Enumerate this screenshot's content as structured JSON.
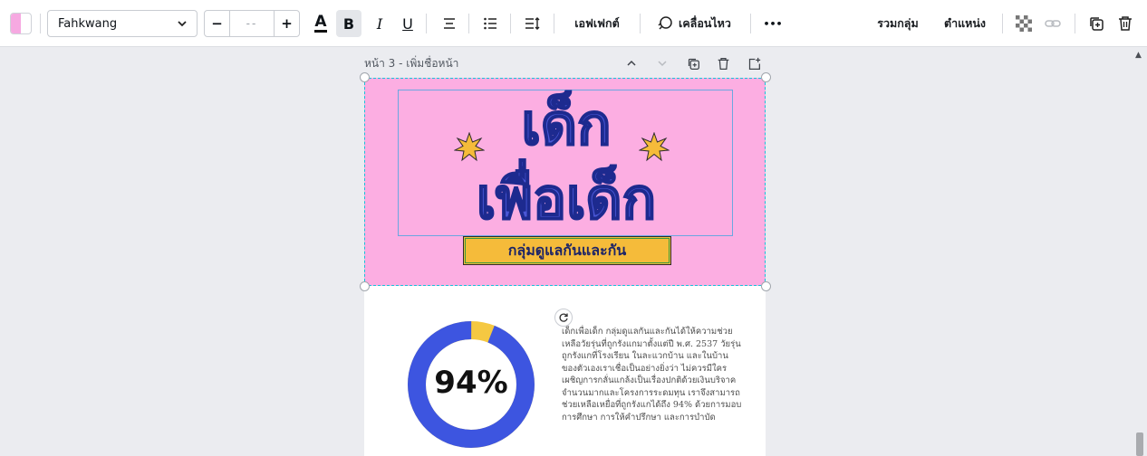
{
  "toolbar": {
    "text_color_swatch": "#f6a9e1",
    "font_name": "Fahkwang",
    "font_size_placeholder": "--",
    "minus_label": "−",
    "plus_label": "+",
    "text_color_icon": "A",
    "bold_label": "B",
    "italic_label": "I",
    "underline_label": "U",
    "effects_label": "เอฟเฟกต์",
    "animate_label": "เคลื่อนไหว",
    "more_label": "•••",
    "group_label": "รวมกลุ่ม",
    "position_label": "ตำแหน่ง",
    "icons": [
      "align-center-icon",
      "list-icon",
      "spacing-icon",
      "animate-icon",
      "transparency-icon",
      "link-icon",
      "duplicate-icon",
      "trash-icon"
    ]
  },
  "page": {
    "label": "หน้า 3 - เพิ่มชื่อหน้า",
    "tool_icons": [
      "chevron-up-icon",
      "chevron-down-icon",
      "duplicate-page-icon",
      "delete-page-icon",
      "add-page-icon"
    ]
  },
  "design": {
    "title_line1": "เด็ก",
    "title_line2": "เพื่อเด็ก",
    "subtitle": "กลุ่มดูแลกันและกัน",
    "banner_color": "#fcaee2",
    "title_color": "#4a57d6",
    "accent_color": "#f5bb3a",
    "stat": {
      "percent_label": "94%",
      "value": 0.94,
      "ring_color": "#3d55e0",
      "remainder_color": "#f5c842"
    },
    "body_text": "เด็กเพื่อเด็ก กลุ่มดูแลกันและกันได้ให้ความช่วยเหลือวัยรุ่นที่ถูกรังแกมาตั้งแต่ปี พ.ศ. 2537 วัยรุ่นถูกรังแกที่โรงเรียน ในละแวกบ้าน และในบ้านของตัวเองเราเชื่อเป็นอย่างยิ่งว่า ไม่ควรมีใครเผชิญการกลั่นแกล้งเป็นเรื่องปกติด้วยเงินบริจาคจำนวนมากและโครงการระดมทุน เราจึงสามารถช่วยเหลือเหยื่อที่ถูกรังแกได้ถึง 94% ด้วยการมอบการศึกษา การให้คำปรึกษา และการบำบัด"
  }
}
